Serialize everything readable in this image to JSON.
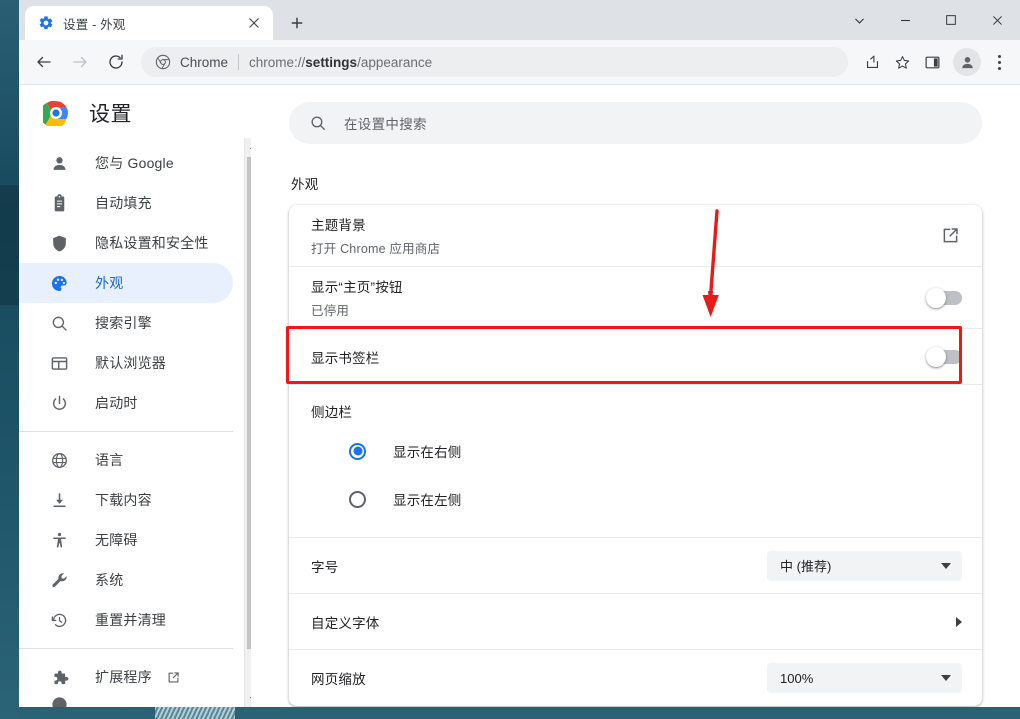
{
  "window": {
    "controls": [
      {
        "name": "tab-search",
        "glyph": "chevron-down"
      },
      {
        "name": "minimize",
        "glyph": "minus"
      },
      {
        "name": "maximize",
        "glyph": "square"
      },
      {
        "name": "close",
        "glyph": "cross"
      }
    ]
  },
  "tabstrip": {
    "tab_title": "设置 - 外观",
    "tab_favicon": "gear-icon",
    "close_label": "✕",
    "newtab_label": "+"
  },
  "toolbar": {
    "back": "←",
    "forward": "→",
    "reload": "⟳",
    "omnibox": {
      "chip_icon": "chrome-icon",
      "chip_text": "Chrome",
      "url_prefix": "chrome://",
      "url_bold": "settings",
      "url_suffix": "/appearance"
    },
    "actions": [
      {
        "name": "share-icon"
      },
      {
        "name": "bookmark-star-icon"
      },
      {
        "name": "side-panel-icon"
      },
      {
        "name": "profile-avatar"
      },
      {
        "name": "three-dot-menu"
      }
    ]
  },
  "sidebar": {
    "brand_title": "设置",
    "brand_logo": "chrome-logo",
    "groups": [
      {
        "items": [
          {
            "label": "您与 Google",
            "icon": "person-icon",
            "active": false
          },
          {
            "label": "自动填充",
            "icon": "clipboard-icon",
            "active": false
          },
          {
            "label": "隐私设置和安全性",
            "icon": "shield-icon",
            "active": false
          },
          {
            "label": "外观",
            "icon": "palette-icon",
            "active": true
          },
          {
            "label": "搜索引擎",
            "icon": "search-icon",
            "active": false
          },
          {
            "label": "默认浏览器",
            "icon": "browser-window-icon",
            "active": false
          },
          {
            "label": "启动时",
            "icon": "power-icon",
            "active": false
          }
        ]
      },
      {
        "items": [
          {
            "label": "语言",
            "icon": "globe-icon",
            "active": false
          },
          {
            "label": "下载内容",
            "icon": "download-icon",
            "active": false
          },
          {
            "label": "无障碍",
            "icon": "accessibility-icon",
            "active": false
          },
          {
            "label": "系统",
            "icon": "wrench-icon",
            "active": false
          },
          {
            "label": "重置并清理",
            "icon": "history-restore-icon",
            "active": false
          }
        ]
      },
      {
        "items": [
          {
            "label": "扩展程序",
            "icon": "puzzle-icon",
            "active": false,
            "external": true
          }
        ]
      }
    ]
  },
  "search": {
    "placeholder": "在设置中搜索",
    "icon": "search-icon"
  },
  "main": {
    "section_title": "外观",
    "rows": {
      "theme": {
        "title": "主题背景",
        "subtitle": "打开 Chrome 应用商店",
        "action_icon": "open-in-new-icon"
      },
      "home_button": {
        "title": "显示“主页”按钮",
        "subtitle": "已停用",
        "toggle_state": "off"
      },
      "bookmarks_bar": {
        "title": "显示书签栏",
        "toggle_state": "off",
        "highlighted": true
      },
      "side_panel": {
        "group_label": "侧边栏",
        "options": [
          {
            "label": "显示在右侧",
            "selected": true
          },
          {
            "label": "显示在左侧",
            "selected": false
          }
        ]
      },
      "font_size": {
        "title": "字号",
        "value": "中 (推荐)"
      },
      "custom_fonts": {
        "title": "自定义字体",
        "chevron": "chevron-right"
      },
      "page_zoom": {
        "title": "网页缩放",
        "value": "100%"
      }
    }
  },
  "annotation": {
    "highlight_color": "#f21616",
    "arrow_color": "#e81b1b",
    "target": "显示书签栏"
  },
  "scrollbar": {
    "up_arrow": "▲",
    "down_arrow": "▼"
  }
}
